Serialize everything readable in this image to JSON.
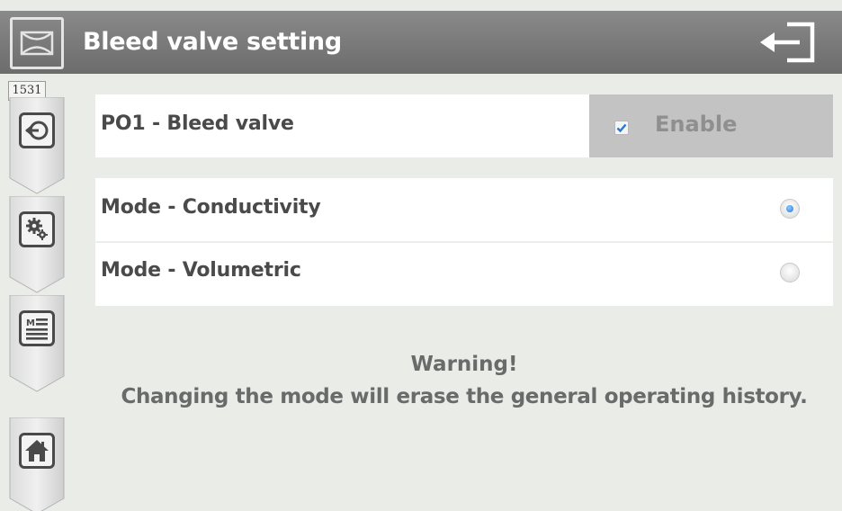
{
  "header": {
    "title": "Bleed valve setting",
    "logo_icon": "valve-logo-icon",
    "exit_icon": "exit-arrow-icon"
  },
  "sidebar": {
    "counter": "1531",
    "buttons": [
      {
        "name": "back",
        "icon": "back-arrow-icon"
      },
      {
        "name": "settings",
        "icon": "gears-icon"
      },
      {
        "name": "menu",
        "icon": "menu-list-icon"
      },
      {
        "name": "home",
        "icon": "home-icon"
      }
    ]
  },
  "output": {
    "label": "PO1 - Bleed valve",
    "enable_label": "Enable",
    "enable_checked": true
  },
  "modes": [
    {
      "label": "Mode - Conductivity",
      "selected": true
    },
    {
      "label": "Mode - Volumetric",
      "selected": false
    }
  ],
  "warning": {
    "title": "Warning!",
    "text": "Changing the mode will erase the general operating history."
  },
  "colors": {
    "header_bar": "#7c7c7c",
    "enable_bg": "#c3c3c3",
    "check_accent": "#1e7ae0",
    "text_dark": "#4a4a4a",
    "text_warning": "#6a6a6a"
  }
}
